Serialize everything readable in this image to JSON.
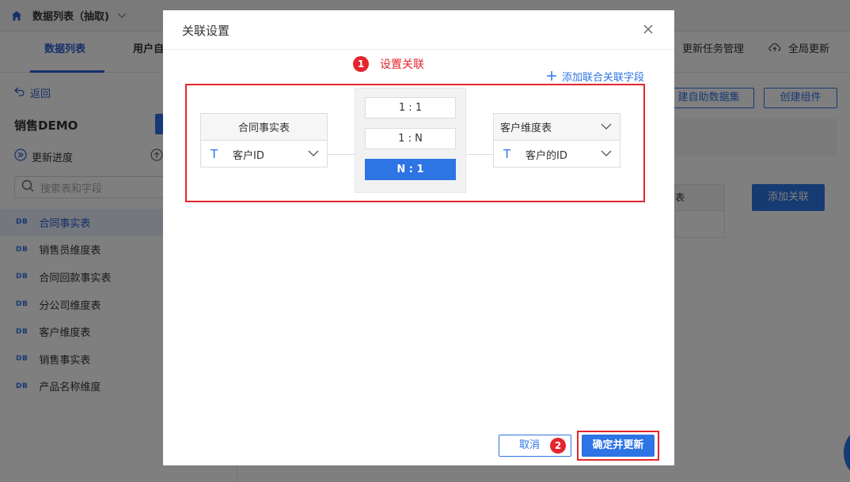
{
  "app": {
    "title": "数据列表（抽取)",
    "nav_tabs": [
      {
        "label": "数据列表",
        "active": true
      },
      {
        "label": "用户自"
      }
    ],
    "nav_right": {
      "update_task_mgmt": "更新任务管理",
      "global_update": "全局更新"
    },
    "sidebar": {
      "back_label": "返回",
      "title": "销售DEMO",
      "update_progress": "更新进度",
      "search_placeholder": "搜索表和字段",
      "db_tag": "DB",
      "items": [
        {
          "label": "合同事实表",
          "active": true
        },
        {
          "label": "销售员维度表"
        },
        {
          "label": "合同回款事实表"
        },
        {
          "label": "分公司维度表"
        },
        {
          "label": "客户维度表"
        },
        {
          "label": "销售事实表"
        },
        {
          "label": "产品名称维度"
        }
      ]
    },
    "main": {
      "create_dataset_label": "建自助数据集",
      "create_component_label": "创建组件",
      "table_header_partial": "表",
      "add_relation_label": "添加关联"
    }
  },
  "modal": {
    "title": "关联设置",
    "step1_badge": "1",
    "step1_text": "设置关联",
    "add_union_field_label": "添加联合关联字段",
    "left_table": {
      "name": "合同事实表",
      "field": "客户ID",
      "field_type_icon": "T"
    },
    "right_table": {
      "name": "客户维度表",
      "field": "客户的ID",
      "field_type_icon": "T"
    },
    "ratios": [
      {
        "label": "1 : 1",
        "selected": false
      },
      {
        "label": "1 : N",
        "selected": false
      },
      {
        "label": "N : 1",
        "selected": true
      }
    ],
    "cancel_label": "取消",
    "step2_badge": "2",
    "confirm_label": "确定并更新"
  },
  "colors": {
    "accent": "#2d74e5",
    "annotation_red": "#e3262d"
  }
}
